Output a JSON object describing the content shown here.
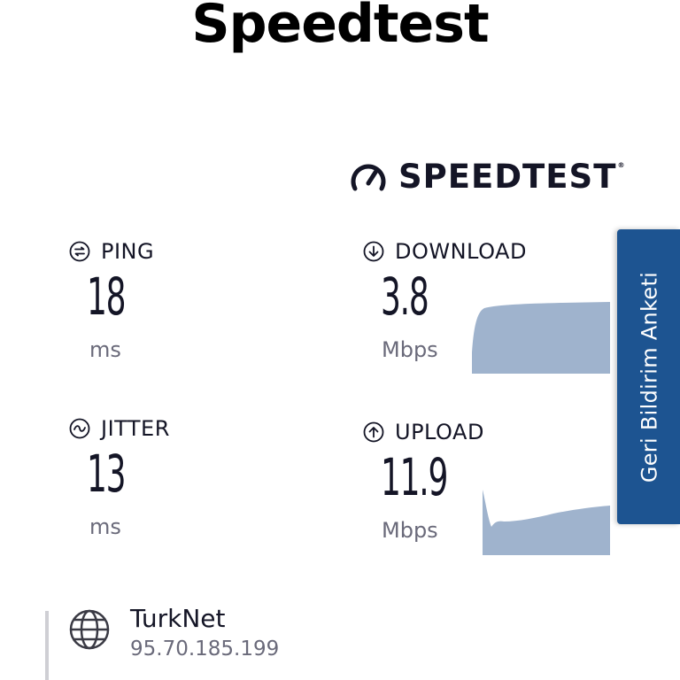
{
  "page": {
    "title": "Speedtest"
  },
  "brand": {
    "name": "SPEEDTEST",
    "trademark": "®",
    "icon": "gauge-icon"
  },
  "metrics": {
    "ping": {
      "label": "PING",
      "value": "18",
      "unit": "ms",
      "icon": "ping-icon"
    },
    "jitter": {
      "label": "JITTER",
      "value": "13",
      "unit": "ms",
      "icon": "jitter-icon"
    },
    "download": {
      "label": "DOWNLOAD",
      "value": "3.8",
      "unit": "Mbps",
      "icon": "download-arrow-icon"
    },
    "upload": {
      "label": "UPLOAD",
      "value": "11.9",
      "unit": "Mbps",
      "icon": "upload-arrow-icon"
    }
  },
  "survey": {
    "label": "Geri Bildirim Anketi"
  },
  "isp": {
    "name": "TurkNet",
    "ip": "95.70.185.199",
    "icon": "globe-icon"
  },
  "colors": {
    "graph_fill": "#9fb3cd",
    "survey_bg": "#1d5491",
    "text": "#141526",
    "muted": "#6a6a7a"
  }
}
